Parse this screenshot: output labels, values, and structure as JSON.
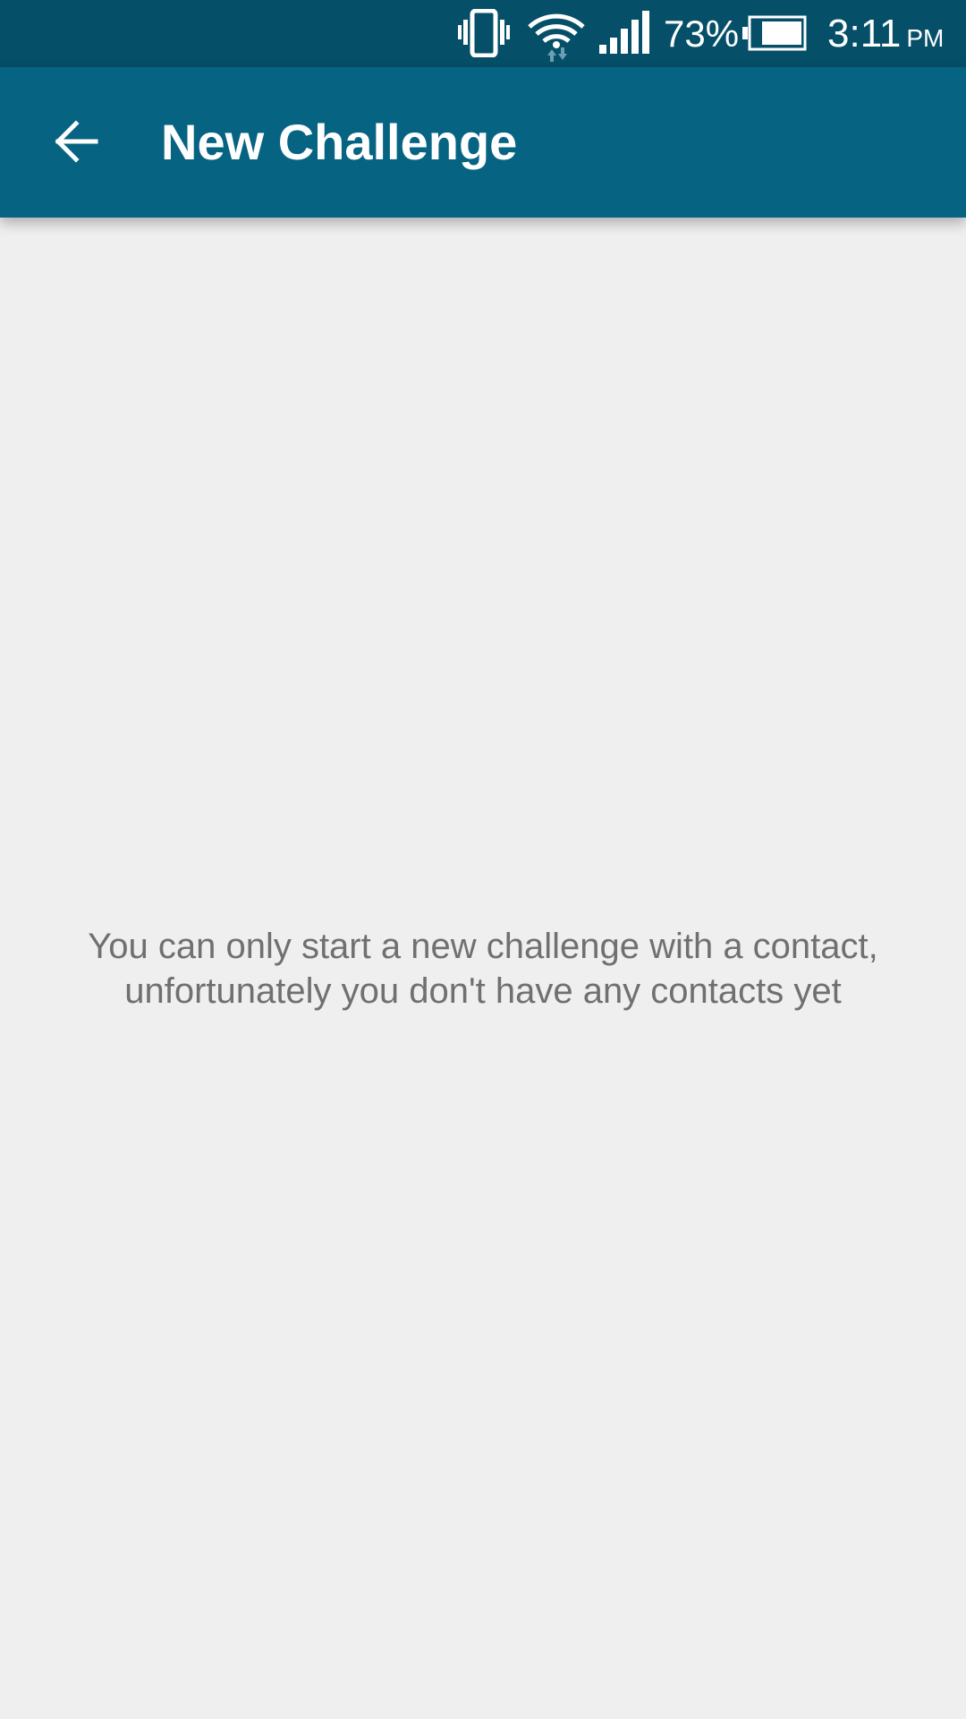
{
  "status_bar": {
    "battery_percent": "73%",
    "time": "3:11",
    "ampm": "PM",
    "icons": [
      "vibrate-icon",
      "wifi-icon",
      "signal-icon",
      "battery-icon"
    ]
  },
  "app_bar": {
    "title": "New Challenge",
    "back_icon": "arrow-back-icon"
  },
  "main": {
    "empty_message_line1": "You can only start a new challenge with a contact,",
    "empty_message_line2": "unfortunately you don't have any contacts yet"
  },
  "colors": {
    "status_bar": "#054f68",
    "app_bar": "#066482",
    "background": "#efefef",
    "message_text": "#707070"
  }
}
